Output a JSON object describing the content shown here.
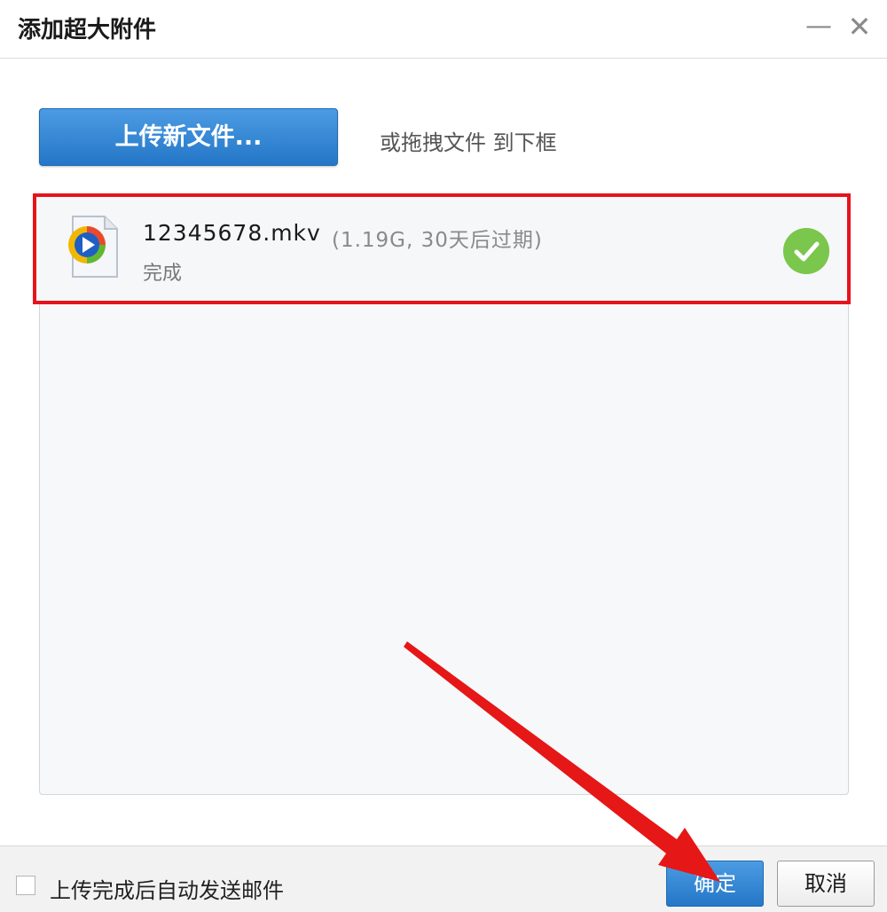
{
  "window": {
    "title": "添加超大附件",
    "minimize_glyph": "—",
    "close_glyph": "✕"
  },
  "upload": {
    "button_label": "上传新文件...",
    "drag_hint": "或拖拽文件 到下框"
  },
  "file": {
    "icon": "video-file-icon",
    "name": "12345678.mkv",
    "meta": "(1.19G, 30天后过期)",
    "status": "完成",
    "status_icon": "check-circle-icon"
  },
  "footer": {
    "auto_send_label": "上传完成后自动发送邮件",
    "auto_send_checked": false,
    "ok_label": "确定",
    "cancel_label": "取消"
  },
  "colors": {
    "accent_blue": "#2f86d6",
    "highlight_red": "#e5141c",
    "success_green": "#7bc64c"
  }
}
